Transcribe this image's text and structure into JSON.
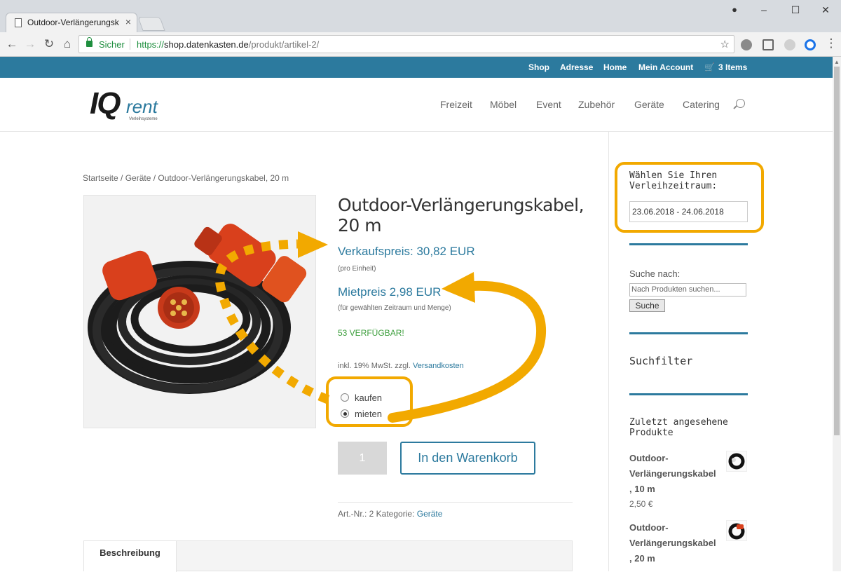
{
  "browser": {
    "tab_title": "Outdoor-Verlängerungsk",
    "secure_label": "Sicher",
    "url_scheme": "https://",
    "url_host": "shop.datenkasten.de",
    "url_path": "/produkt/artikel-2/"
  },
  "topbar": {
    "links": [
      "Shop",
      "Adresse",
      "Home",
      "Mein Account"
    ],
    "cart": "3 Items"
  },
  "logo": {
    "main": "IQ",
    "accent": "rent",
    "tagline": "Verleihsysteme"
  },
  "nav": [
    "Freizeit",
    "Möbel",
    "Event",
    "Zubehör",
    "Geräte",
    "Catering"
  ],
  "breadcrumb": "Startseite / Geräte / Outdoor-Verlängerungskabel, 20 m",
  "product": {
    "title_line1": "Outdoor-Verlängerungskabel,",
    "title_line2": "20 m",
    "sale_price": "Verkaufspreis: 30,82 EUR",
    "sale_note": "(pro Einheit)",
    "rent_price": "Mietpreis 2,98 EUR",
    "rent_note": "(für gewählten Zeitraum und Menge)",
    "stock": "53 VERFÜGBAR!",
    "tax_text": "inkl. 19% MwSt. zzgl.",
    "shipping_link": "Versandkosten",
    "option_buy": "kaufen",
    "option_rent": "mieten",
    "selected_option": "mieten",
    "quantity": "1",
    "cart_button": "In den Warenkorb",
    "meta_text": "Art.-Nr.: 2 Kategorie:",
    "category_link": "Geräte"
  },
  "tabs": {
    "description": "Beschreibung"
  },
  "sidebar": {
    "period_title_line1": "Wählen Sie Ihren",
    "period_title_line2": "Verleihzeitraum:",
    "date_range": "23.06.2018 - 24.06.2018",
    "search_label": "Suche nach:",
    "search_placeholder": "Nach Produkten suchen...",
    "search_button": "Suche",
    "filter_title": "Suchfilter",
    "recent_title_line1": "Zuletzt angesehene",
    "recent_title_line2": "Produkte",
    "recent": [
      {
        "line1": "Outdoor-",
        "line2": "Verlängerungskabel",
        "line3": ", 10 m",
        "price": "2,50 €"
      },
      {
        "line1": "Outdoor-",
        "line2": "Verlängerungskabel",
        "line3": ", 20 m"
      }
    ]
  },
  "colors": {
    "brand": "#2c7a9e",
    "highlight": "#f2a900",
    "stock": "#3e9f3e"
  }
}
